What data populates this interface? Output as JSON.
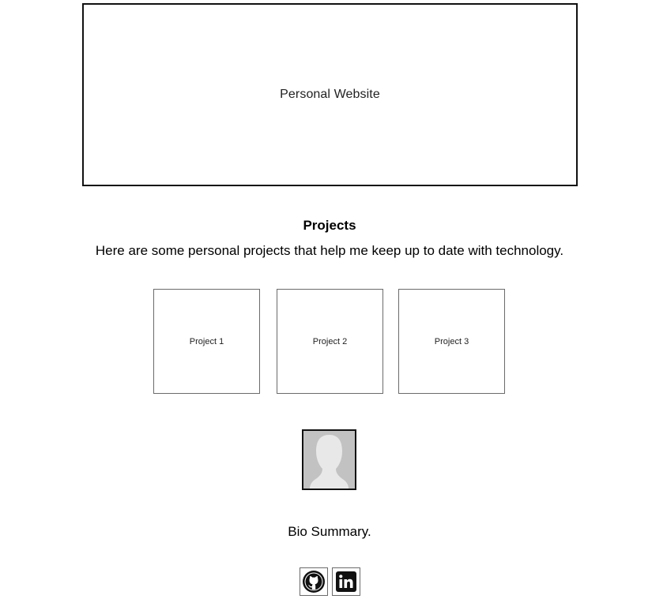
{
  "header": {
    "title": "Personal Website"
  },
  "projects": {
    "heading": "Projects",
    "description": "Here are some personal projects that help me keep up to date with technology.",
    "items": [
      {
        "label": "Project 1"
      },
      {
        "label": "Project 2"
      },
      {
        "label": "Project 3"
      }
    ]
  },
  "profile": {
    "avatar_icon": "person-silhouette-icon",
    "bio": "Bio Summary."
  },
  "social": {
    "links": [
      {
        "icon": "github-icon"
      },
      {
        "icon": "linkedin-icon"
      }
    ]
  },
  "colors": {
    "border_dark": "#111111",
    "border_gray": "#6b6b6b",
    "avatar_bg": "#b9b9b9",
    "avatar_figure": "#e6e6e6"
  }
}
